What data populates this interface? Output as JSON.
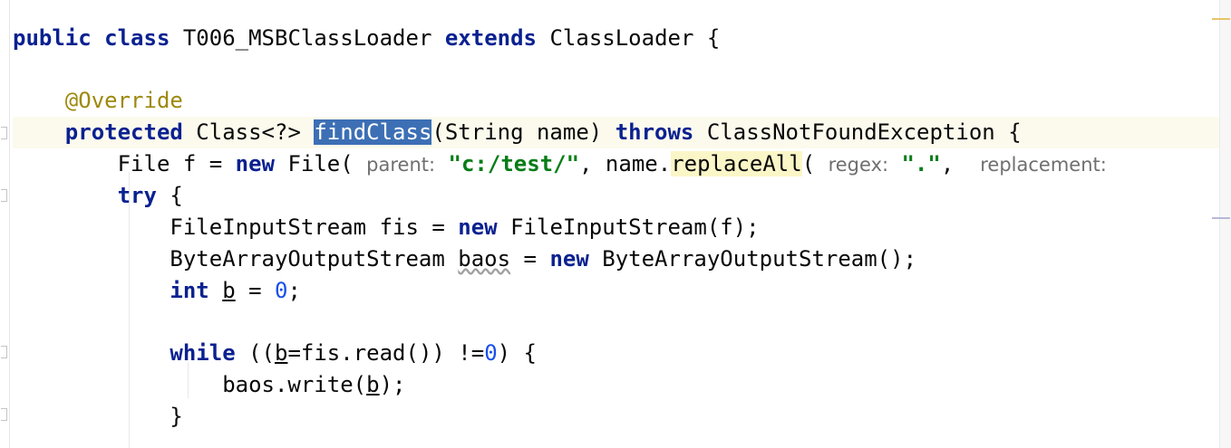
{
  "editor": {
    "lines": [
      {
        "class_kw": "public",
        "class_word": "class",
        "class_name": "T006_MSBClassLoader",
        "extends_kw": "extends",
        "super_name": "ClassLoader",
        "brace": "{"
      },
      {
        "annotation": "@Override"
      },
      {
        "modifier": "protected",
        "return_type": "Class<?>",
        "method_name": "findClass",
        "params": "(String name)",
        "throws_kw": "throws",
        "exception": "ClassNotFoundException",
        "brace": "{"
      },
      {
        "type": "File f = ",
        "new_kw": "new",
        "ctor": "File(",
        "hint_parent": "parent:",
        "str_path": "\"c:/test/\"",
        "mid": ", name.",
        "call": "replaceAll",
        "open": "(",
        "hint_regex": "regex:",
        "str_dot": "\".\"",
        "comma": ",",
        "hint_replacement": "replacement:"
      },
      {
        "try_kw": "try",
        "brace": "{"
      },
      {
        "left": "FileInputStream fis = ",
        "new_kw": "new",
        "right": "FileInputStream(f);"
      },
      {
        "left": "ByteArrayOutputStream ",
        "var": "baos",
        "mid": " = ",
        "new_kw": "new",
        "right": "ByteArrayOutputStream();"
      },
      {
        "int_kw": "int",
        "var": "b",
        "mid": " = ",
        "num": "0",
        "end": ";"
      },
      {
        "while_kw": "while",
        "a": "((",
        "var": "b",
        "b": "=fis.read()) !=",
        "num": "0",
        "c": ") {"
      },
      {
        "a": "baos.write(",
        "var": "b",
        "b": ");"
      },
      {
        "brace": "}"
      }
    ]
  },
  "colors": {
    "keyword": "#0a2190",
    "annotation": "#9e880d",
    "string": "#067d17",
    "number": "#1750eb",
    "selection": "#3d6fb5"
  }
}
